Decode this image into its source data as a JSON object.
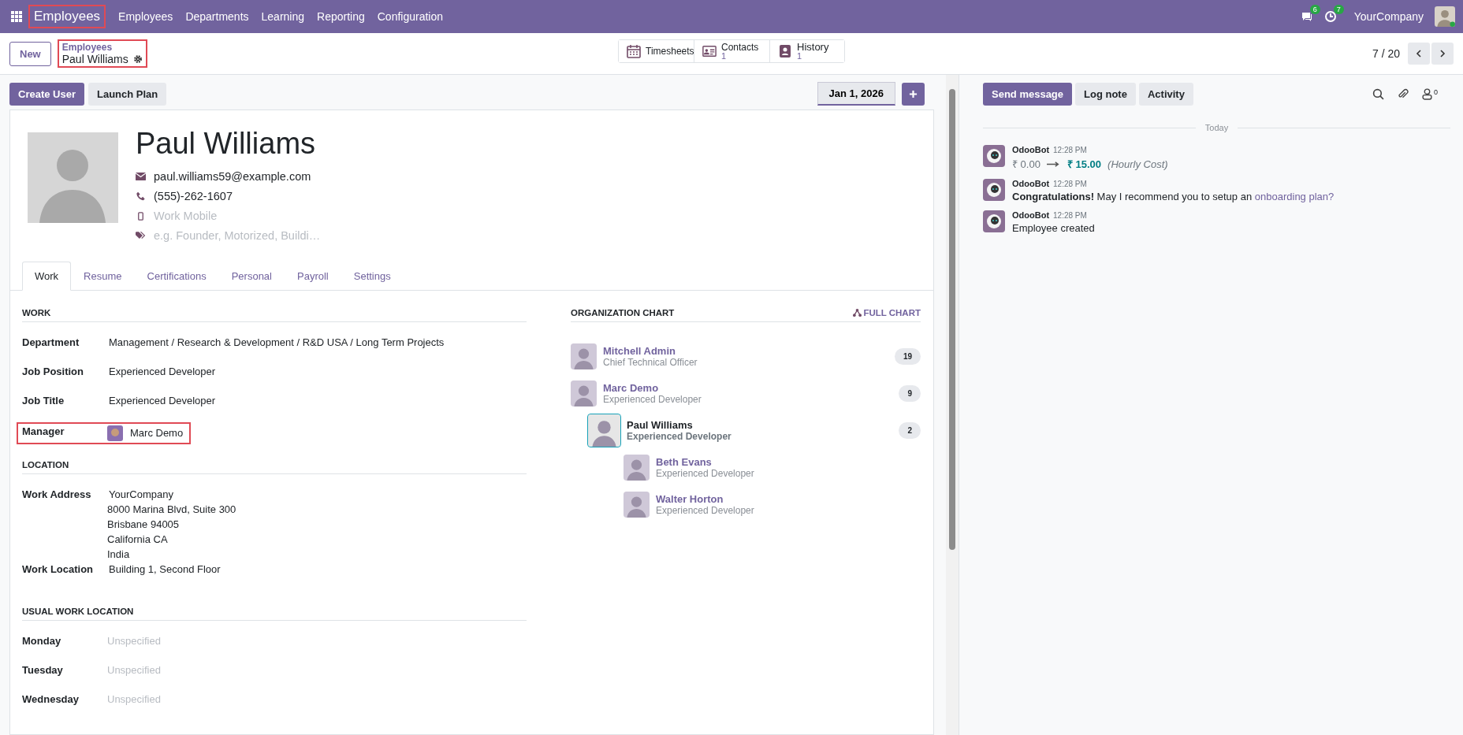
{
  "navbar": {
    "app_name": "Employees",
    "app_highlighted": true,
    "menu": [
      "Employees",
      "Departments",
      "Learning",
      "Reporting",
      "Configuration"
    ],
    "messages_badge": "6",
    "activities_badge": "7",
    "company": "YourCompany"
  },
  "control_panel": {
    "new_button": "New",
    "breadcrumb_parent": "Employees",
    "breadcrumb_current": "Paul Williams",
    "breadcrumb_highlighted": true,
    "smart_buttons": [
      {
        "label": "Timesheets",
        "kind": "calendar"
      },
      {
        "label": "Contacts",
        "count": "1",
        "kind": "card"
      },
      {
        "label": "History",
        "count": "1",
        "kind": "badge"
      }
    ],
    "pager": "7 / 20"
  },
  "actions": {
    "buttons": [
      {
        "label": "Create User",
        "primary": true
      },
      {
        "label": "Launch Plan",
        "primary": false
      }
    ],
    "date": "Jan 1, 2026"
  },
  "employee": {
    "name": "Paul Williams",
    "email": "paul.williams59@example.com",
    "phone": "(555)-262-1607",
    "mobile_placeholder": "Work Mobile",
    "tags_placeholder": "e.g. Founder, Motorized, Buildi…"
  },
  "tabs": [
    {
      "label": "Work",
      "selected": true
    },
    {
      "label": "Resume",
      "selected": false
    },
    {
      "label": "Certifications",
      "selected": false
    },
    {
      "label": "Personal",
      "selected": false
    },
    {
      "label": "Payroll",
      "selected": false
    },
    {
      "label": "Settings",
      "selected": false
    }
  ],
  "sections": [
    {
      "title": "WORK",
      "fields": [
        {
          "label": "Department",
          "value": "Management / Research & Development / R&D USA / Long Term Projects"
        },
        {
          "label": "Job Position",
          "value": "Experienced Developer"
        },
        {
          "label": "Job Title",
          "value": "Experienced Developer"
        },
        {
          "label": "Manager",
          "value": "Marc Demo",
          "kind": "user",
          "highlighted": true
        }
      ]
    },
    {
      "title": "LOCATION",
      "fields": [
        {
          "label": "Work Address",
          "value": "YourCompany",
          "lines": [
            "8000 Marina Blvd, Suite 300",
            "Brisbane 94005",
            "California CA",
            "India"
          ]
        },
        {
          "label": "Work Location",
          "value": "Building 1, Second Floor"
        }
      ]
    },
    {
      "title": "USUAL WORK LOCATION",
      "fields": [
        {
          "label": "Monday",
          "placeholder": "Unspecified"
        },
        {
          "label": "Tuesday",
          "placeholder": "Unspecified"
        },
        {
          "label": "Wednesday",
          "placeholder": "Unspecified"
        }
      ]
    }
  ],
  "org_chart": {
    "title": "ORGANIZATION CHART",
    "full_chart": "FULL CHART",
    "nodes": [
      {
        "name": "Mitchell Admin",
        "job": "Chief Technical Officer",
        "count": "19",
        "selected": false,
        "children": [
          {
            "name": "Marc Demo",
            "job": "Experienced Developer",
            "count": "9",
            "selected": false,
            "children": [
              {
                "name": "Paul Williams",
                "job": "Experienced Developer",
                "count": "2",
                "selected": true,
                "children": [
                  {
                    "name": "Beth Evans",
                    "job": "Experienced Developer",
                    "selected": false
                  },
                  {
                    "name": "Walter Horton",
                    "job": "Experienced Developer",
                    "selected": false
                  }
                ]
              }
            ]
          }
        ]
      }
    ]
  },
  "chatter": {
    "buttons": [
      {
        "label": "Send message",
        "primary": true
      },
      {
        "label": "Log note",
        "primary": false
      },
      {
        "label": "Activity",
        "primary": false
      }
    ],
    "followers": "0",
    "divider": "Today",
    "messages": [
      {
        "author": "OdooBot",
        "time": "12:28 PM",
        "kind": "tracking",
        "old": "₹ 0.00",
        "new": "₹ 15.00",
        "field": "(Hourly Cost)"
      },
      {
        "author": "OdooBot",
        "time": "12:28 PM",
        "kind": "text",
        "body": "**Congratulations!** May I recommend you to setup an ",
        "link": "onboarding plan?"
      },
      {
        "author": "OdooBot",
        "time": "12:28 PM",
        "kind": "text",
        "body": "Employee created"
      }
    ]
  }
}
